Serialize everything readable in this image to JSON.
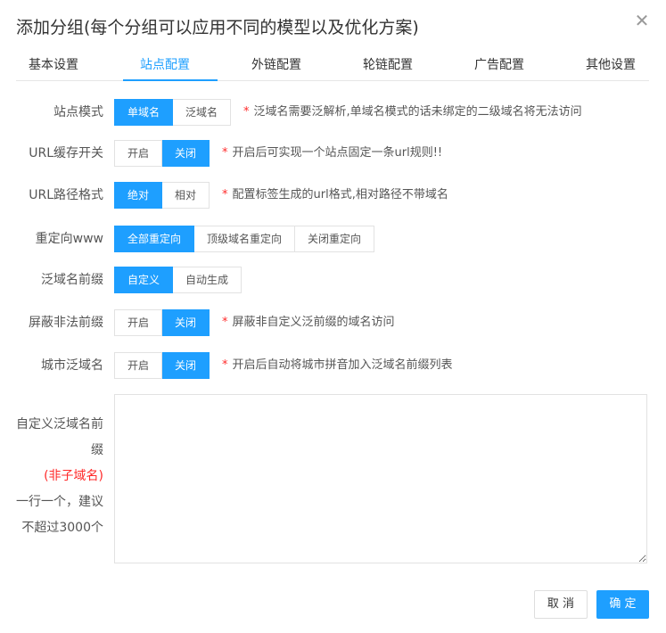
{
  "dialog": {
    "title": "添加分组(每个分组可以应用不同的模型以及优化方案)",
    "close_icon": "close-icon"
  },
  "tabs": [
    {
      "label": "基本设置",
      "active": false
    },
    {
      "label": "站点配置",
      "active": true
    },
    {
      "label": "外链配置",
      "active": false
    },
    {
      "label": "轮链配置",
      "active": false
    },
    {
      "label": "广告配置",
      "active": false
    },
    {
      "label": "其他设置",
      "active": false
    }
  ],
  "fields": {
    "site_mode": {
      "label": "站点模式",
      "options": [
        "单域名",
        "泛域名"
      ],
      "selected": "单域名",
      "hint": "泛域名需要泛解析,单域名模式的话未绑定的二级域名将无法访问"
    },
    "url_cache": {
      "label": "URL缓存开关",
      "options": [
        "开启",
        "关闭"
      ],
      "selected": "关闭",
      "hint": "开启后可实现一个站点固定一条url规则!!"
    },
    "url_path": {
      "label": "URL路径格式",
      "options": [
        "绝对",
        "相对"
      ],
      "selected": "绝对",
      "hint": "配置标签生成的url格式,相对路径不带域名"
    },
    "redirect_www": {
      "label": "重定向www",
      "options": [
        "全部重定向",
        "顶级域名重定向",
        "关闭重定向"
      ],
      "selected": "全部重定向"
    },
    "wildcard_prefix": {
      "label": "泛域名前缀",
      "options": [
        "自定义",
        "自动生成"
      ],
      "selected": "自定义"
    },
    "block_illegal_prefix": {
      "label": "屏蔽非法前缀",
      "options": [
        "开启",
        "关闭"
      ],
      "selected": "关闭",
      "hint": "屏蔽非自定义泛前缀的域名访问"
    },
    "city_wildcard": {
      "label": "城市泛域名",
      "options": [
        "开启",
        "关闭"
      ],
      "selected": "关闭",
      "hint": "开启后自动将城市拼音加入泛域名前缀列表"
    },
    "custom_prefix": {
      "label_line1": "自定义泛域名前",
      "label_line2": "缀",
      "label_note": "(非子域名)",
      "label_line3": "一行一个，建议",
      "label_line4": "不超过3000个",
      "value": ""
    }
  },
  "footer": {
    "cancel_label": "取 消",
    "ok_label": "确 定"
  },
  "colors": {
    "accent": "#1e9fff",
    "required_star": "#ff2a2a"
  }
}
